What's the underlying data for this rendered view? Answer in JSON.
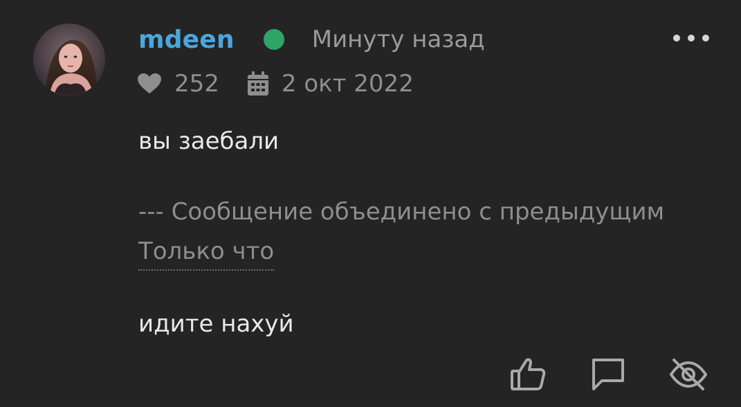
{
  "post": {
    "author": {
      "username": "mdeen",
      "status_color": "#2ea566",
      "avatar_icon": "user-avatar-photo"
    },
    "time_ago": "Минуту назад",
    "likes": "252",
    "registration_date": "2 окт 2022",
    "messages": {
      "first": "вы заебали",
      "merge_note": "--- Сообщение объединено с предыдущим",
      "merge_time": "Только что",
      "second": "идите нахуй"
    }
  },
  "actions": {
    "more": "more-dots-icon",
    "like": "thumbs-up-icon",
    "reply": "reply-speech-bubble-icon",
    "hide": "eye-off-icon"
  },
  "colors": {
    "background": "#242424",
    "username": "#4aa6dd",
    "text": "#e9e9e9",
    "muted": "#8e8e8e"
  }
}
